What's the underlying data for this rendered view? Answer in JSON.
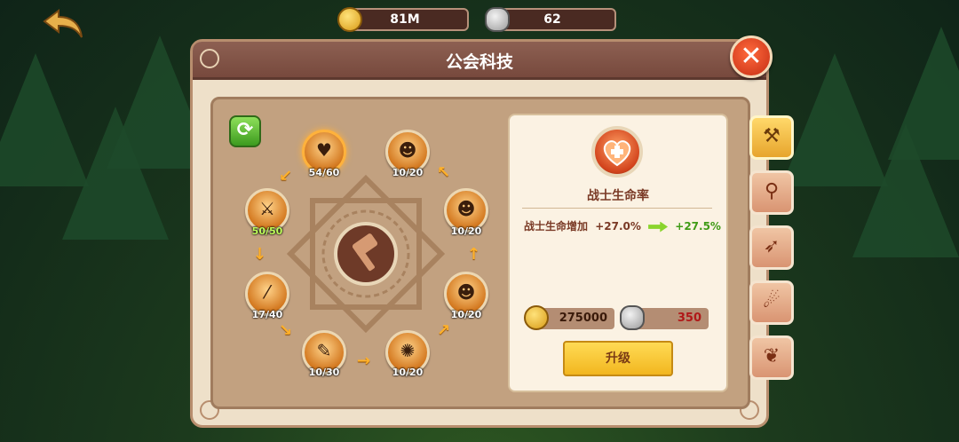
{
  "header": {
    "gold_value": "81M",
    "stone_value": "62",
    "icons": {
      "back": "back-arrow-icon",
      "gold": "gold-coin-icon",
      "stone": "stone-icon"
    }
  },
  "panel": {
    "title": "公会科技",
    "close_icon": "close-icon"
  },
  "tree": {
    "nodes": [
      {
        "id": "heart",
        "label": "54/60",
        "icon": "heart-plus-icon",
        "active": true
      },
      {
        "id": "warrior-a",
        "label": "10/20",
        "icon": "warrior-silhouette-icon"
      },
      {
        "id": "sword",
        "label": "50/50",
        "icon": "sword-shield-icon",
        "full": true
      },
      {
        "id": "warrior-b",
        "label": "10/20",
        "icon": "fire-warrior-icon"
      },
      {
        "id": "slash",
        "label": "17/40",
        "icon": "slash-icon"
      },
      {
        "id": "warrior-c",
        "label": "10/20",
        "icon": "dash-warrior-icon"
      },
      {
        "id": "scroll",
        "label": "10/30",
        "icon": "scroll-icon"
      },
      {
        "id": "explosion",
        "label": "10/20",
        "icon": "explosion-icon"
      }
    ]
  },
  "detail": {
    "name": "战士生命率",
    "effect_label": "战士生命增加",
    "current_value": "+27.0%",
    "next_value": "+27.5%",
    "gold_cost": "275000",
    "stone_cost": "350",
    "upgrade_label": "升级",
    "colors": {
      "stone_cost_insufficient": "#b01818",
      "next_value": "#3f9b16"
    }
  },
  "tabs": [
    {
      "id": "warrior",
      "icon": "hammer-icon",
      "active": true
    },
    {
      "id": "mage",
      "icon": "staff-icon"
    },
    {
      "id": "archer",
      "icon": "bow-icon"
    },
    {
      "id": "beast",
      "icon": "claw-icon"
    },
    {
      "id": "support",
      "icon": "wings-icon"
    }
  ]
}
